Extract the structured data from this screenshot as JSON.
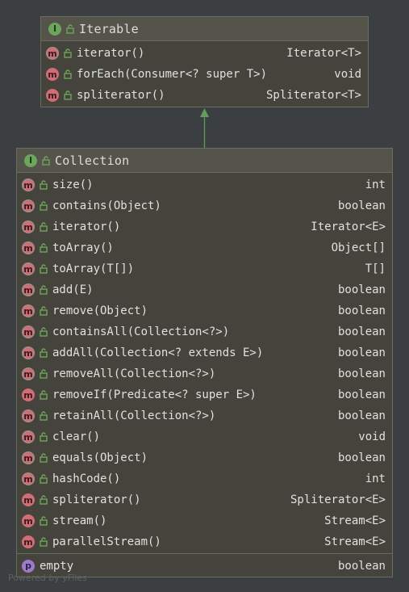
{
  "diagram": {
    "parent": {
      "name": "Iterable",
      "kind_badge": "I",
      "methods": [
        {
          "signature": "iterator()",
          "return_type": "Iterator<T>",
          "badge": "m",
          "abstract": true
        },
        {
          "signature": "forEach(Consumer<? super T>)",
          "return_type": "void",
          "badge": "m",
          "abstract": false
        },
        {
          "signature": "spliterator()",
          "return_type": "Spliterator<T>",
          "badge": "m",
          "abstract": false
        }
      ]
    },
    "child": {
      "name": "Collection",
      "kind_badge": "I",
      "methods": [
        {
          "signature": "size()",
          "return_type": "int",
          "badge": "m",
          "abstract": true
        },
        {
          "signature": "contains(Object)",
          "return_type": "boolean",
          "badge": "m",
          "abstract": true
        },
        {
          "signature": "iterator()",
          "return_type": "Iterator<E>",
          "badge": "m",
          "abstract": true
        },
        {
          "signature": "toArray()",
          "return_type": "Object[]",
          "badge": "m",
          "abstract": true
        },
        {
          "signature": "toArray(T[])",
          "return_type": "T[]",
          "badge": "m",
          "abstract": true
        },
        {
          "signature": "add(E)",
          "return_type": "boolean",
          "badge": "m",
          "abstract": true
        },
        {
          "signature": "remove(Object)",
          "return_type": "boolean",
          "badge": "m",
          "abstract": true
        },
        {
          "signature": "containsAll(Collection<?>)",
          "return_type": "boolean",
          "badge": "m",
          "abstract": true
        },
        {
          "signature": "addAll(Collection<? extends E>)",
          "return_type": "boolean",
          "badge": "m",
          "abstract": true
        },
        {
          "signature": "removeAll(Collection<?>)",
          "return_type": "boolean",
          "badge": "m",
          "abstract": true
        },
        {
          "signature": "removeIf(Predicate<? super E>)",
          "return_type": "boolean",
          "badge": "m",
          "abstract": false
        },
        {
          "signature": "retainAll(Collection<?>)",
          "return_type": "boolean",
          "badge": "m",
          "abstract": true
        },
        {
          "signature": "clear()",
          "return_type": "void",
          "badge": "m",
          "abstract": true
        },
        {
          "signature": "equals(Object)",
          "return_type": "boolean",
          "badge": "m",
          "abstract": true
        },
        {
          "signature": "hashCode()",
          "return_type": "int",
          "badge": "m",
          "abstract": true
        },
        {
          "signature": "spliterator()",
          "return_type": "Spliterator<E>",
          "badge": "m",
          "abstract": false
        },
        {
          "signature": "stream()",
          "return_type": "Stream<E>",
          "badge": "m",
          "abstract": false
        },
        {
          "signature": "parallelStream()",
          "return_type": "Stream<E>",
          "badge": "m",
          "abstract": false
        }
      ],
      "properties": [
        {
          "name": "empty",
          "type": "boolean",
          "badge": "p"
        }
      ]
    },
    "relationship": "extends",
    "arrow_color": "#5f9e5a"
  },
  "watermark": "Powered by yFiles",
  "colors": {
    "background": "#3c3f41",
    "box_fill": "#45443c",
    "header_fill": "#55544a",
    "border": "#6c6b62",
    "method_badge": "#d16d76",
    "interface_badge": "#6ea55c",
    "property_badge": "#9c7bc9",
    "lock_icon": "#6ea55c"
  }
}
